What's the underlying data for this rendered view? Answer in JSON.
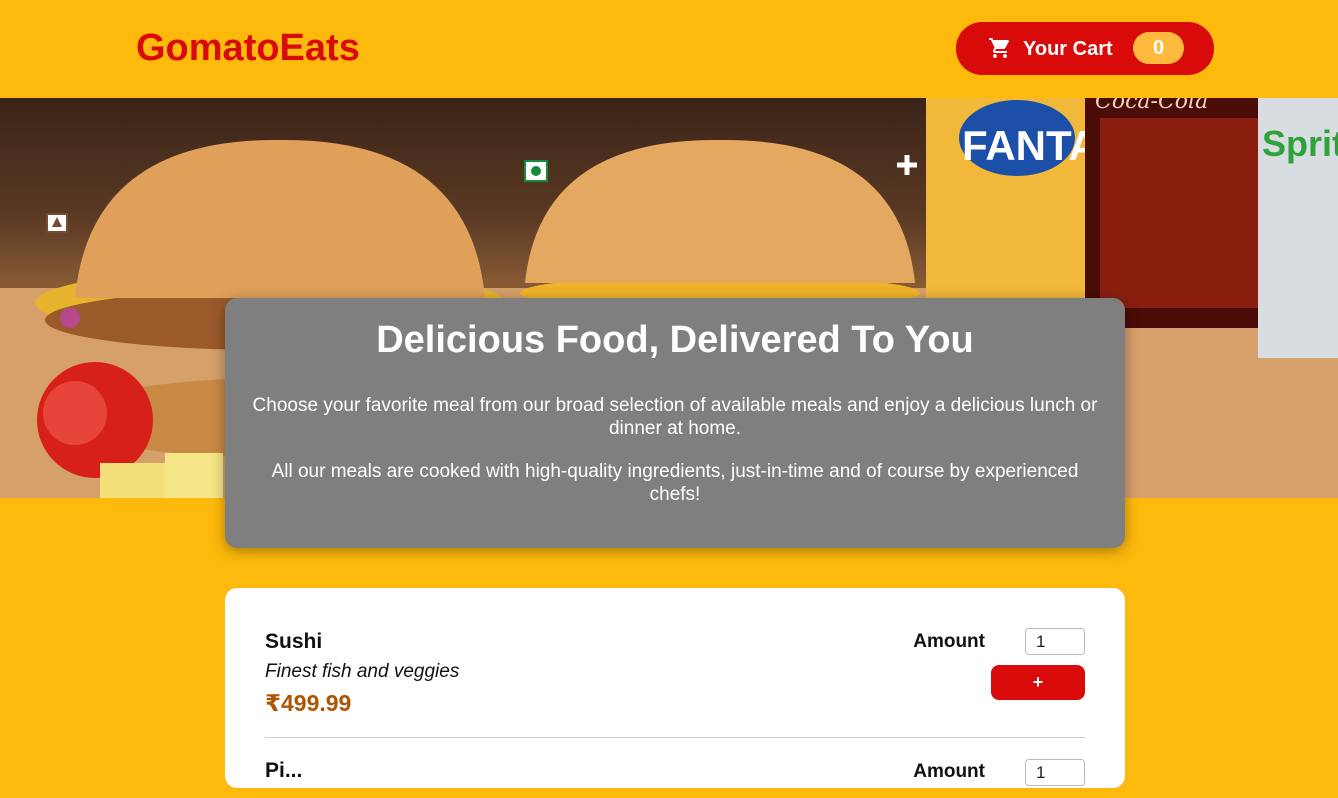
{
  "header": {
    "logo": "GomatoEats",
    "cart_label": "Your Cart",
    "cart_count": "0",
    "cart_icon": "shopping-cart-icon"
  },
  "hero": {
    "bottle_labels": [
      "FANTA",
      "Coca-Cola",
      "Sprite"
    ]
  },
  "summary": {
    "title": "Delicious Food, Delivered To You",
    "paragraph_1": "Choose your favorite meal from our broad selection of available meals and enjoy a delicious lunch or dinner at home.",
    "paragraph_2": "All our meals are cooked with high-quality ingredients, just-in-time and of course by experienced chefs!"
  },
  "meals": [
    {
      "name": "Sushi",
      "description": "Finest fish and veggies",
      "price": "₹499.99",
      "amount_label": "Amount",
      "amount_value": "1",
      "add_label": "+"
    },
    {
      "name": "Pi...",
      "amount_label": "Amount",
      "amount_value": "1"
    }
  ],
  "colors": {
    "background": "#fdba0c",
    "brand_red": "#d80a0a",
    "price": "#ad5502",
    "summary_bg": "#7f7f7f"
  }
}
